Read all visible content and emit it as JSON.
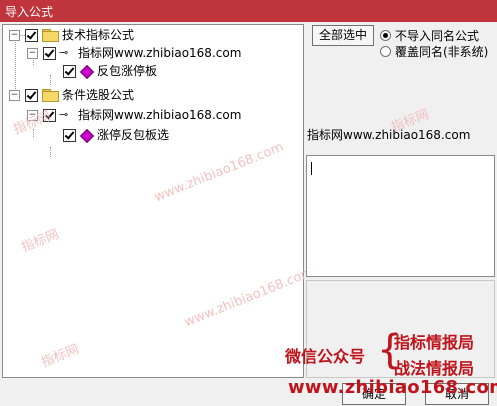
{
  "window": {
    "title": "导入公式"
  },
  "tree": {
    "nodes": [
      {
        "label": "技术指标公式",
        "checked": true
      },
      {
        "label": "指标网www.zhibiao168.com",
        "checked": true
      },
      {
        "label": "反包涨停板",
        "checked": true
      },
      {
        "label": "条件选股公式",
        "checked": true
      },
      {
        "label": "指标网www.zhibiao168.com",
        "checked": true
      },
      {
        "label": "涨停反包板选",
        "checked": true
      }
    ]
  },
  "right": {
    "select_all": "全部选中",
    "radio1": "不导入同名公式",
    "radio2": "覆盖同名(非系统)",
    "path": "指标网www.zhibiao168.com"
  },
  "buttons": {
    "ok": "确定",
    "cancel": "取消"
  },
  "watermark": {
    "text1": "指标网",
    "text2": "www.zhibiao168.com"
  },
  "promo": {
    "wechat": "微信公众号",
    "name1": "指标情报局",
    "name2": "战法情报局",
    "url": "www.zhibiao168.com"
  },
  "colors": {
    "titlebar": "#c0343c",
    "promo": "#c0141c"
  }
}
